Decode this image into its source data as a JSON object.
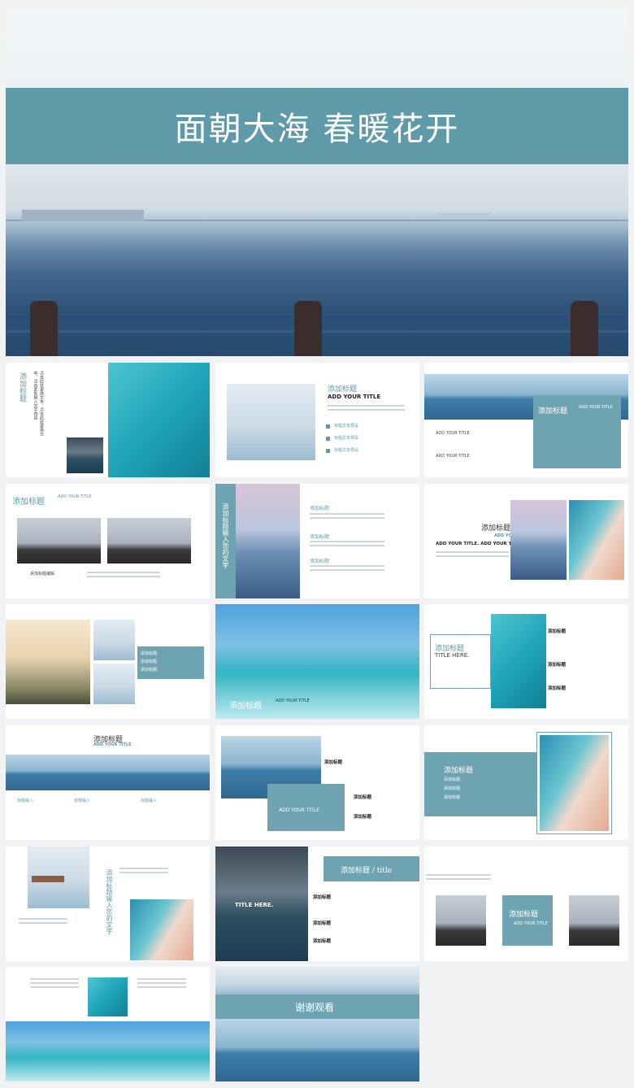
{
  "hero": {
    "title": "面朝大海 春暖花开"
  },
  "slides": {
    "s1": {
      "title": "添加标题",
      "body": "点击此处更换文本，点击此处更换文本，点击此处输入文字内容"
    },
    "s2": {
      "title": "添加标题",
      "subtitle": "ADD YOUR TITLE",
      "item1": "标题文本预设",
      "item2": "标题文本预设",
      "item3": "标题文本预设"
    },
    "s3": {
      "title": "添加标题",
      "subtitle": "ADD YOUR TITLE",
      "label1": "ADD YOUR TITLE",
      "label2": "ADD YOUR TITLE"
    },
    "s4": {
      "title": "添加标题",
      "subtitle": "ADD YOUR TITLE",
      "caption": "添加标题编辑"
    },
    "s5": {
      "vtitle": "添加标题输入您的文字",
      "h1": "添加标题",
      "h2": "添加标题",
      "h3": "添加标题"
    },
    "s6": {
      "title": "添加标题",
      "subtitle": "ADD YOUR TITLE",
      "caption": "ADD YOUR TITLE. ADD YOUR TITLE."
    },
    "s7": {
      "items": [
        "添加标题",
        "添加标题",
        "添加标题"
      ]
    },
    "s8": {
      "title": "添加标题",
      "subtitle": "ADD YOUR TITLE"
    },
    "s9": {
      "title": "添加标题",
      "subtitle": "TITLE HERE.",
      "items": [
        "添加标题",
        "添加标题",
        "添加标题"
      ]
    },
    "s10": {
      "title": "添加标题",
      "subtitle": "ADD YOUR TITLE",
      "cols": [
        "标题输入",
        "标题输入",
        "标题输入"
      ]
    },
    "s11": {
      "caption": "添加标题",
      "label": "ADD YOUR TITLE",
      "items": [
        "添加标题",
        "添加标题"
      ]
    },
    "s12": {
      "title": "添加标题",
      "items": [
        "添加标题",
        "添加标题",
        "添加标题"
      ]
    },
    "s13": {
      "vtitle": "添加标题输入您的文字"
    },
    "s14": {
      "banner": "添加标题 / title",
      "overlay": "TITLE HERE.",
      "items": [
        "添加标题",
        "添加标题",
        "添加标题"
      ]
    },
    "s15": {
      "title": "添加标题",
      "subtitle": "ADD YOUR TITLE"
    },
    "s16": {},
    "s17": {
      "title": "谢谢观看"
    }
  }
}
